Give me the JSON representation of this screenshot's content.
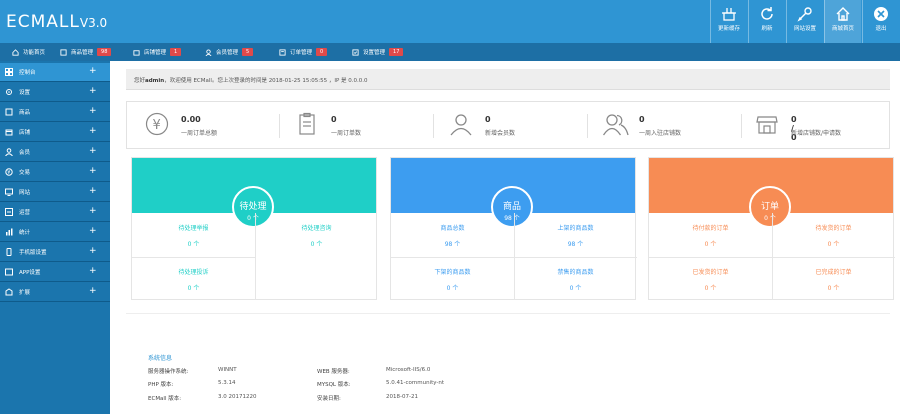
{
  "header": {
    "logo": "ECMALL",
    "version": "V3.0",
    "buttons": [
      {
        "label": "更新缓存",
        "icon": "clear-cache-icon"
      },
      {
        "label": "刷新",
        "icon": "refresh-icon"
      },
      {
        "label": "网站设置",
        "icon": "settings-icon"
      },
      {
        "label": "商城首页",
        "icon": "home-icon"
      },
      {
        "label": "退出",
        "icon": "logout-icon"
      }
    ]
  },
  "quickbar": [
    {
      "label": "功能首页",
      "icon": "home-icon"
    },
    {
      "label": "商品管理",
      "icon": "goods-icon",
      "badge": "98"
    },
    {
      "label": "店铺管理",
      "icon": "store-icon",
      "badge": "1"
    },
    {
      "label": "会员管理",
      "icon": "member-icon",
      "badge": "5"
    },
    {
      "label": "订单管理",
      "icon": "order-icon",
      "badge": "0"
    },
    {
      "label": "设置管理",
      "icon": "setting-icon",
      "badge": "17"
    }
  ],
  "sidebar": {
    "items": [
      {
        "label": "控制台",
        "icon": "dashboard-icon"
      },
      {
        "label": "设置",
        "icon": "settings-icon"
      },
      {
        "label": "商品",
        "icon": "goods-icon"
      },
      {
        "label": "店铺",
        "icon": "store-icon"
      },
      {
        "label": "会员",
        "icon": "member-icon"
      },
      {
        "label": "交易",
        "icon": "trade-icon"
      },
      {
        "label": "网站",
        "icon": "website-icon"
      },
      {
        "label": "运营",
        "icon": "operate-icon"
      },
      {
        "label": "统计",
        "icon": "stats-icon"
      },
      {
        "label": "手机版设置",
        "icon": "mobile-icon"
      },
      {
        "label": "APP设置",
        "icon": "app-icon"
      },
      {
        "label": "扩展",
        "icon": "extend-icon"
      }
    ],
    "expand_symbol": "+"
  },
  "welcome": {
    "prefix": "您好",
    "user": "admin",
    "text": "，欢迎使用 ECMall。您上次登录的时间是 2018-01-25 15:05:55 ，IP 是 0.0.0.0"
  },
  "stats": [
    {
      "value": "0.00",
      "label": "一周订单总额",
      "icon": "yen-icon"
    },
    {
      "value": "0",
      "label": "一周订单数",
      "icon": "clipboard-icon"
    },
    {
      "value": "0",
      "label": "新增会员数",
      "icon": "user-icon"
    },
    {
      "value": "0",
      "label": "一周入驻店铺数",
      "icon": "users-icon"
    },
    {
      "value": "0 / 0",
      "label": "新增店铺数/申请数",
      "icon": "shop-icon"
    }
  ],
  "panels": [
    {
      "title": "待处理",
      "count": "0 个",
      "color": "#1fcfc7",
      "cells": [
        {
          "label": "待处理举报",
          "value": "0 个"
        },
        {
          "label": "待处理咨询",
          "value": "0 个"
        },
        {
          "label": "待处理投诉",
          "value": "0 个"
        }
      ]
    },
    {
      "title": "商品",
      "count": "98 个",
      "color": "#3d9df0",
      "cells": [
        {
          "label": "商品总数",
          "value": "98 个"
        },
        {
          "label": "上架的商品数",
          "value": "98 个"
        },
        {
          "label": "下架的商品数",
          "value": "0 个"
        },
        {
          "label": "禁售的商品数",
          "value": "0 个"
        }
      ]
    },
    {
      "title": "订单",
      "count": "0 个",
      "color": "#f78c54",
      "cells": [
        {
          "label": "待付款的订单",
          "value": "0 个"
        },
        {
          "label": "待发货的订单",
          "value": "0 个"
        },
        {
          "label": "已发货的订单",
          "value": "0 个"
        },
        {
          "label": "已完成的订单",
          "value": "0 个"
        }
      ]
    }
  ],
  "sysinfo": {
    "title": "系统信息",
    "left": [
      {
        "key": "服务器操作系统:",
        "value": "WINNT"
      },
      {
        "key": "PHP 版本:",
        "value": "5.3.14"
      },
      {
        "key": "ECMall 版本:",
        "value": "3.0 20171220"
      }
    ],
    "right": [
      {
        "key": "WEB 服务器:",
        "value": "Microsoft-IIS/6.0"
      },
      {
        "key": "MYSQL 版本:",
        "value": "5.0.41-community-nt"
      },
      {
        "key": "安装日期:",
        "value": "2018-07-21"
      }
    ]
  },
  "colors": {
    "header": "#2f95d3",
    "subbar": "#1d6fa5",
    "sidebar": "#1b75ad",
    "badge": "#e04a4a",
    "sysinfo_title": "#2f95d3"
  }
}
